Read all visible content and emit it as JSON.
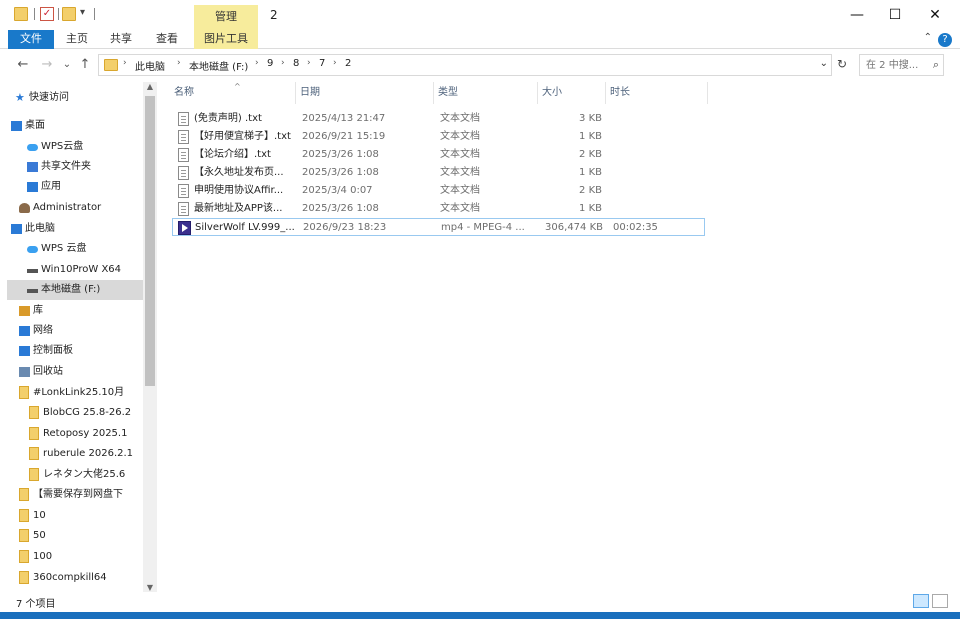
{
  "window": {
    "title": "2",
    "contextual_tab": "管理",
    "buttons": {
      "minimize": "—",
      "maximize": "☐",
      "close": "✕"
    }
  },
  "ribbon": {
    "tabs": [
      "文件",
      "主页",
      "共享",
      "查看",
      "图片工具"
    ],
    "help": "?",
    "collapse": "⌃"
  },
  "nav": {
    "back": "←",
    "forward": "→",
    "recent": "⌄",
    "up": "↑",
    "breadcrumb": [
      "此电脑",
      "本地磁盘 (F:)",
      "9",
      "8",
      "7",
      "2"
    ],
    "breadcrumb_sep": "›",
    "refresh": "↻",
    "search_placeholder": "在 2 中搜..."
  },
  "sidebar": {
    "items": [
      {
        "label": "快速访问",
        "icon": "star-icon",
        "color": "#2a7ad6"
      },
      {
        "label": "桌面",
        "icon": "desktop-icon",
        "color": "#2a7ad6"
      },
      {
        "label": "WPS云盘",
        "icon": "cloud-icon",
        "color": "#3aa0f0"
      },
      {
        "label": "共享文件夹",
        "icon": "share-icon",
        "color": "#3a7ad6"
      },
      {
        "label": "应用",
        "icon": "apps-icon",
        "color": "#2a7ad6"
      },
      {
        "label": "Administrator",
        "icon": "user-icon",
        "color": "#8a6a4a"
      },
      {
        "label": "此电脑",
        "icon": "computer-icon",
        "color": "#2a7ad6"
      },
      {
        "label": "WPS 云盘",
        "icon": "cloud-icon",
        "color": "#3aa0f0"
      },
      {
        "label": "Win10ProW X64",
        "icon": "drive-icon",
        "color": "#555555"
      },
      {
        "label": "本地磁盘 (F:)",
        "icon": "drive-icon",
        "color": "#555555"
      },
      {
        "label": "库",
        "icon": "library-icon",
        "color": "#d99a2a"
      },
      {
        "label": "网络",
        "icon": "network-icon",
        "color": "#2a7ad6"
      },
      {
        "label": "控制面板",
        "icon": "control-panel-icon",
        "color": "#2a7ad6"
      },
      {
        "label": "回收站",
        "icon": "recycle-bin-icon",
        "color": "#6a8ab0"
      },
      {
        "label": "#LonkLink25.10月",
        "icon": "folder-icon",
        "color": "#f3cf6b"
      },
      {
        "label": "BlobCG 25.8-26.2",
        "icon": "folder-icon",
        "color": "#f3cf6b"
      },
      {
        "label": "Retoposy 2025.1",
        "icon": "folder-icon",
        "color": "#f3cf6b"
      },
      {
        "label": "ruberule 2026.2.1",
        "icon": "folder-icon",
        "color": "#f3cf6b"
      },
      {
        "label": "レネタン大佬25.6",
        "icon": "folder-icon",
        "color": "#f3cf6b"
      },
      {
        "label": "【需要保存到网盘下",
        "icon": "folder-icon",
        "color": "#f3cf6b"
      },
      {
        "label": "10",
        "icon": "folder-icon",
        "color": "#f3cf6b"
      },
      {
        "label": "50",
        "icon": "folder-icon",
        "color": "#f3cf6b"
      },
      {
        "label": "100",
        "icon": "folder-icon",
        "color": "#f3cf6b"
      },
      {
        "label": "360compkill64",
        "icon": "folder-icon",
        "color": "#f3cf6b"
      }
    ],
    "selected": "本地磁盘 (F:)"
  },
  "files": {
    "columns": [
      "名称",
      "日期",
      "类型",
      "大小",
      "时长"
    ],
    "sort_indicator": "^",
    "rows": [
      {
        "name": "(免责声明) .txt",
        "date": "2025/4/13 21:47",
        "type": "文本文档",
        "size": "3 KB",
        "duration": "",
        "icon": "text-file-icon"
      },
      {
        "name": "【好用便宜梯子】.txt",
        "date": "2026/9/21 15:19",
        "type": "文本文档",
        "size": "1 KB",
        "duration": "",
        "icon": "text-file-icon"
      },
      {
        "name": "【论坛介绍】.txt",
        "date": "2025/3/26 1:08",
        "type": "文本文档",
        "size": "2 KB",
        "duration": "",
        "icon": "text-file-icon"
      },
      {
        "name": "【永久地址发布页...",
        "date": "2025/3/26 1:08",
        "type": "文本文档",
        "size": "1 KB",
        "duration": "",
        "icon": "text-file-icon"
      },
      {
        "name": "申明使用协议Affir...",
        "date": "2025/3/4 0:07",
        "type": "文本文档",
        "size": "2 KB",
        "duration": "",
        "icon": "text-file-icon"
      },
      {
        "name": "最新地址及APP该...",
        "date": "2025/3/26 1:08",
        "type": "文本文档",
        "size": "1 KB",
        "duration": "",
        "icon": "text-file-icon"
      },
      {
        "name": "SilverWolf LV.999_...",
        "date": "2026/9/23 18:23",
        "type": "mp4 - MPEG-4 ...",
        "size": "306,474 KB",
        "duration": "00:02:35",
        "icon": "video-file-icon"
      }
    ],
    "selected_index": 6
  },
  "status": {
    "item_count": "7 个项目"
  }
}
